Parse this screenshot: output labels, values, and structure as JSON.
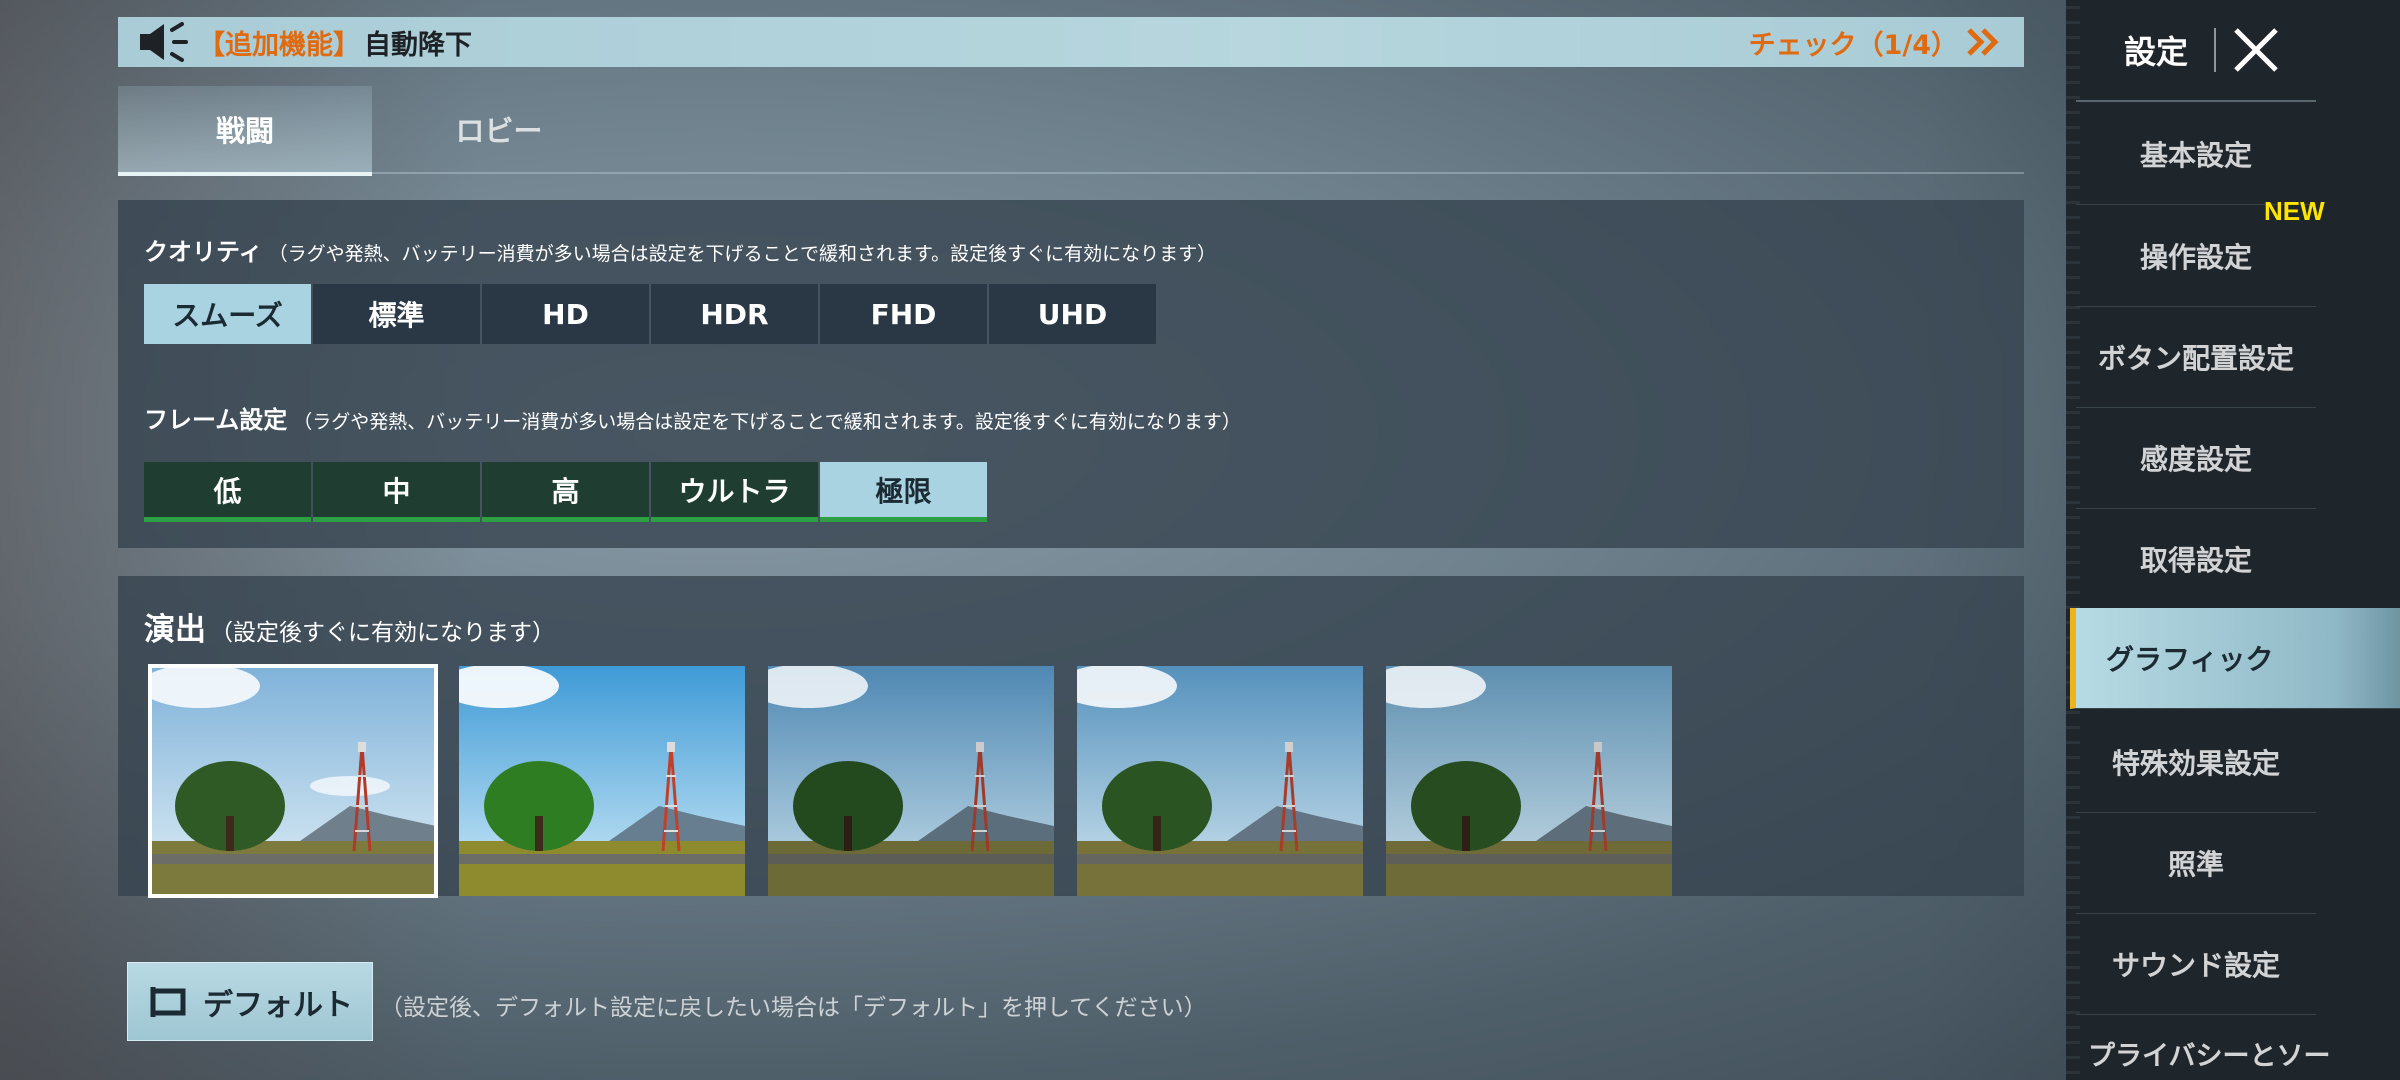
{
  "announce": {
    "tag": "【追加機能】",
    "title": "自動降下",
    "check": "チェック（1/4）"
  },
  "tabs": [
    {
      "label": "戦闘",
      "active": true
    },
    {
      "label": "ロビー",
      "active": false
    }
  ],
  "quality": {
    "label": "クオリティ",
    "note": "（ラグや発熱、バッテリー消費が多い場合は設定を下げることで緩和されます。設定後すぐに有効になります）",
    "options": [
      "スムーズ",
      "標準",
      "HD",
      "HDR",
      "FHD",
      "UHD"
    ],
    "selected": "スムーズ"
  },
  "frame": {
    "label": "フレーム設定",
    "note": "（ラグや発熱、バッテリー消費が多い場合は設定を下げることで緩和されます。設定後すぐに有効になります）",
    "options": [
      "低",
      "中",
      "高",
      "ウルトラ",
      "極限"
    ],
    "selected": "極限"
  },
  "effects": {
    "label": "演出",
    "note": "（設定後すぐに有効になります）",
    "thumbnails": 5,
    "selected_index": 0
  },
  "default_button": {
    "label": "デフォルト",
    "hint": "（設定後、デフォルト設定に戻したい場合は「デフォルト」を押してください）"
  },
  "sidebar": {
    "title": "設定",
    "items": [
      {
        "label": "基本設定"
      },
      {
        "label": "操作設定",
        "badge": "NEW"
      },
      {
        "label": "ボタン配置設定"
      },
      {
        "label": "感度設定"
      },
      {
        "label": "取得設定"
      },
      {
        "label": "グラフィック",
        "active": true
      },
      {
        "label": "特殊効果設定"
      },
      {
        "label": "照準"
      },
      {
        "label": "サウンド設定"
      },
      {
        "label": "プライバシーとソー"
      }
    ]
  },
  "colors": {
    "accent_orange": "#e06a10",
    "selected_bg": "#a9d3e0",
    "frame_green": "#2ea044",
    "sidebar_highlight": "#f0b418",
    "new_badge": "#ffe400"
  }
}
